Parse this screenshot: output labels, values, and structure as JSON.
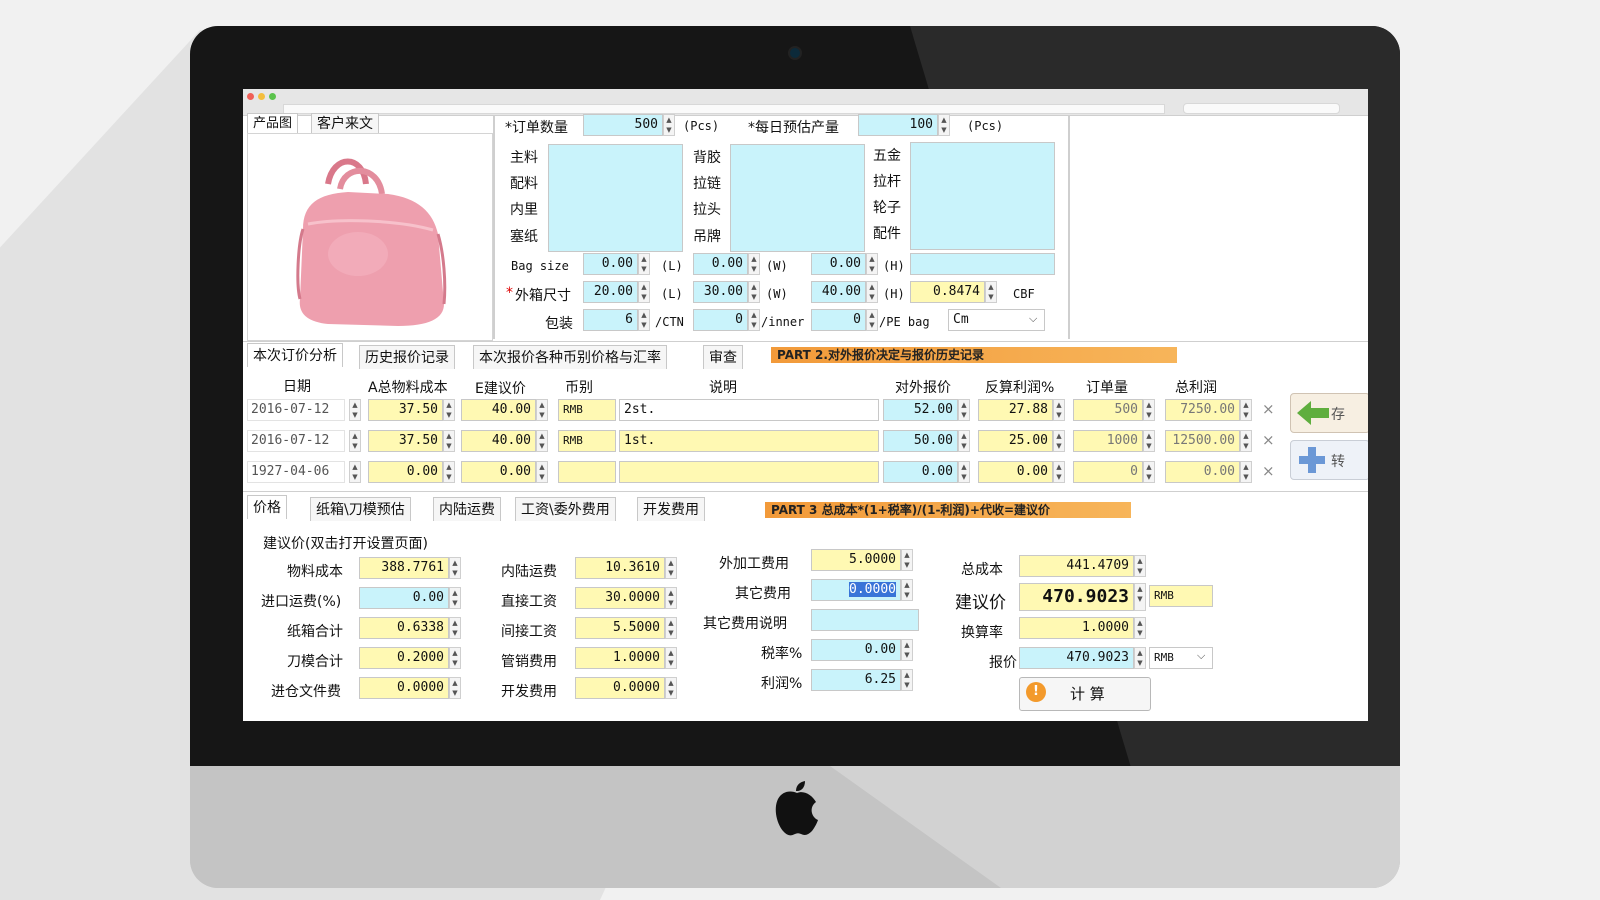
{
  "colors": {
    "yellow_field": "#fff9b3",
    "cyan_field": "#c9f3fb",
    "orange_banner": "#f7a64a"
  },
  "left_panel": {
    "tab_product": "产品图",
    "tab_customer": "客户来文"
  },
  "order": {
    "qty_label": "*订单数量",
    "qty_value": "500",
    "qty_unit": "(Pcs)",
    "daily_label": "*每日预估产量",
    "daily_value": "100",
    "daily_unit": "(Pcs)"
  },
  "materials": {
    "col1": [
      "主料",
      "配料",
      "内里",
      "塞纸"
    ],
    "col2": [
      "背胶",
      "拉链",
      "拉头",
      "吊牌"
    ],
    "col3": [
      "五金",
      "拉杆",
      "轮子",
      "配件"
    ]
  },
  "bagsize": {
    "label": "Bag size",
    "l": "0.00",
    "w": "0.00",
    "h": "0.00",
    "l_unit": "(L)",
    "w_unit": "(W)",
    "h_unit": "(H)"
  },
  "carton": {
    "label": "外箱尺寸",
    "star": "*",
    "l": "20.00",
    "w": "30.00",
    "h": "40.00",
    "l_unit": "(L)",
    "w_unit": "(W)",
    "h_unit": "(H)",
    "cbf_value": "0.8474",
    "cbf_unit": "CBF"
  },
  "packing": {
    "label": "包装",
    "per_ctn": "6",
    "ctn_unit": "/CTN",
    "per_inner": "0",
    "inner_unit": "/inner",
    "per_bag": "0",
    "bag_unit": "/PE bag",
    "unit_select": "Cm"
  },
  "tabs2": [
    "本次订价分析",
    "历史报价记录",
    "本次报价各种币别价格与汇率",
    "审查"
  ],
  "banner2": "PART 2.对外报价决定与报价历史记录",
  "table": {
    "headers": [
      "日期",
      "A总物料成本",
      "E建议价",
      "币别",
      "说明",
      "对外报价",
      "反算利润%",
      "订单量",
      "总利润"
    ],
    "rows": [
      {
        "date": "2016-07-12",
        "cost": "37.50",
        "suggest": "40.00",
        "currency": "RMB",
        "note": "2st.",
        "quote": "52.00",
        "profit": "27.88",
        "qty": "500",
        "total": "7250.00"
      },
      {
        "date": "2016-07-12",
        "cost": "37.50",
        "suggest": "40.00",
        "currency": "RMB",
        "note": "1st.",
        "quote": "50.00",
        "profit": "25.00",
        "qty": "1000",
        "total": "12500.00"
      },
      {
        "date": "1927-04-06",
        "cost": "0.00",
        "suggest": "0.00",
        "currency": "",
        "note": "",
        "quote": "0.00",
        "profit": "0.00",
        "qty": "0",
        "total": "0.00"
      }
    ],
    "btn_top": "存",
    "btn_bottom": "转"
  },
  "tabs3": [
    "价格",
    "纸箱\\刀模预估",
    "内陆运费",
    "工资\\委外费用",
    "开发费用"
  ],
  "banner3": "PART 3 总成本*(1+税率)/(1-利润)+代收=建议价",
  "price": {
    "section_label": "建议价(双击打开设置页面)",
    "col1": [
      [
        "物料成本",
        "388.7761"
      ],
      [
        "进口运费(%)",
        "0.00"
      ],
      [
        "纸箱合计",
        "0.6338"
      ],
      [
        "刀模合计",
        "0.2000"
      ],
      [
        "进仓文件费",
        "0.0000"
      ]
    ],
    "col2": [
      [
        "内陆运费",
        "10.3610"
      ],
      [
        "直接工资",
        "30.0000"
      ],
      [
        "间接工资",
        "5.5000"
      ],
      [
        "管销费用",
        "1.0000"
      ],
      [
        "开发费用",
        "0.0000"
      ]
    ],
    "col3": [
      [
        "外加工费用",
        "5.0000"
      ],
      [
        "其它费用",
        "0.0000"
      ],
      [
        "其它费用说明",
        ""
      ],
      [
        "税率%",
        "0.00"
      ],
      [
        "利润%",
        "6.25"
      ]
    ],
    "total_label": "总成本",
    "total_value": "441.4709",
    "suggest_label": "建议价",
    "suggest_value": "470.9023",
    "suggest_currency": "RMB",
    "rate_label": "换算率",
    "rate_value": "1.0000",
    "quote_label": "报价",
    "quote_value": "470.9023",
    "quote_currency": "RMB",
    "calc_button": "计 算"
  }
}
